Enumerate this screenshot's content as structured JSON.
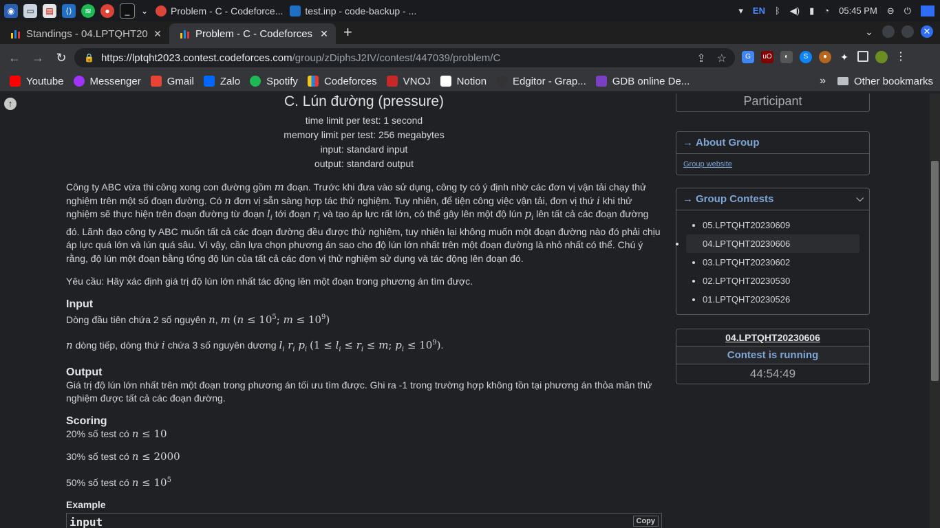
{
  "taskbar": {
    "task1": "Problem - C - Codeforce...",
    "task2": "test.inp - code-backup - ...",
    "lang": "EN",
    "time": "05:45 PM"
  },
  "tabs": [
    {
      "title": "Standings - 04.LPTQHT20",
      "close": "✕"
    },
    {
      "title": "Problem - C - Codeforces",
      "close": "✕"
    }
  ],
  "toolbar": {
    "url_host": "https://lptqht2023.contest.codeforces.com",
    "url_path": "/group/zDiphsJ2IV/contest/447039/problem/C"
  },
  "bookmarks": [
    "Youtube",
    "Messenger",
    "Gmail",
    "Zalo",
    "Spotify",
    "Codeforces",
    "VNOJ",
    "Notion",
    "Edgitor - Grap...",
    "GDB online De..."
  ],
  "bookmarks_more": "»",
  "bookmarks_other": "Other bookmarks",
  "problem": {
    "title": "C. Lún đường (pressure)",
    "time_limit": "time limit per test: 1 second",
    "memory_limit": "memory limit per test: 256 megabytes",
    "input": "input: standard input",
    "output": "output: standard output",
    "statement_1": "Công ty ABC vừa thi công xong con đường gồm",
    "statement_2": "đoạn. Trước khi đưa vào sử dụng, công ty có ý định nhờ các đơn vị vận tải chạy thử nghiệm trên một số đoạn đường. Có",
    "statement_3": "đơn vị sẵn sàng hợp tác thử nghiệm. Tuy nhiên, để tiện công việc vận tải, đơn vị thứ",
    "statement_4": "khi thử nghiệm sẽ thực hiện trên đoạn đường từ đoạn",
    "statement_5": "tới đoạn",
    "statement_6": "và tạo áp lực rất lớn, có thể gây lên một độ lún",
    "statement_7": "lên tất cả các đoạn đường đó. Lãnh đạo công ty ABC muốn tất cả các đoạn đường đều được thử nghiệm, tuy nhiên lại không muốn một đoạn đường nào đó phải chịu áp lực quá lớn và lún quá sâu. Vì vậy, cần lựa chọn phương án sao cho độ lún lớn nhất trên một đoạn đường là nhỏ nhất có thể. Chú ý rằng, độ lún một đoạn bằng tổng độ lún của tất cả các đơn vị thử nghiệm sử dụng và tác động lên đoạn đó.",
    "request": "Yêu cầu: Hãy xác định giá trị độ lún lớn nhất tác động lên một đoạn trong phương án tìm được.",
    "input_h": "Input",
    "input_1": "Dòng đầu tiên chứa 2 số nguyên",
    "input_2a": "dòng tiếp, dòng thứ",
    "input_2b": "chứa 3 số nguyên dương",
    "output_h": "Output",
    "output_text": "Giá trị độ lún lớn nhất trên một đoạn trong phương án tối ưu tìm được. Ghi ra -1 trong trường hợp không tồn tại phương án thỏa mãn thử nghiệm được tất cả các đoạn đường.",
    "scoring_h": "Scoring",
    "score_1": "20% số test có",
    "score_2": "30% số test có",
    "score_3": "50% số test có",
    "example_h": "Example",
    "example_input": "input",
    "copy": "Copy"
  },
  "sidebar": {
    "participant": "Participant",
    "about_h": "About Group",
    "group_link": "Group website",
    "contests_h": "Group Contests",
    "contests": [
      "05.LPTQHT20230609",
      "04.LPTQHT20230606",
      "03.LPTQHT20230602",
      "02.LPTQHT20230530",
      "01.LPTQHT20230526"
    ],
    "running_name": "04.LPTQHT20230606",
    "running_status": "Contest is running",
    "timer": "44:54:49"
  }
}
